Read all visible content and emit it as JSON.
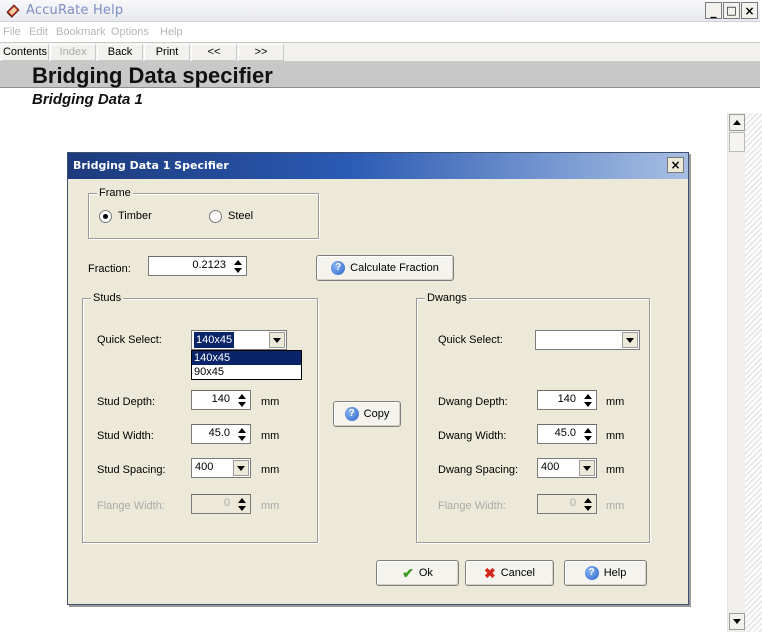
{
  "app": {
    "title": "AccuRate Help",
    "menu": [
      "File",
      "Edit",
      "Bookmark",
      "Options",
      "Help"
    ],
    "toolbar": [
      {
        "label": "Contents",
        "enabled": true
      },
      {
        "label": "Index",
        "enabled": false
      },
      {
        "label": "Back",
        "enabled": true
      },
      {
        "label": "Print",
        "enabled": true
      },
      {
        "label": "<<",
        "enabled": true
      },
      {
        "label": ">>",
        "enabled": true
      }
    ],
    "window_buttons": {
      "minimize": "_",
      "maximize": "□",
      "close": "×"
    }
  },
  "page": {
    "title": "Bridging Data specifier",
    "subtitle": "Bridging Data 1"
  },
  "dialog": {
    "title": "Bridging Data 1 Specifier",
    "close": "×",
    "frame": {
      "group_label": "Frame",
      "options": [
        "Timber",
        "Steel"
      ],
      "selected": "Timber"
    },
    "fraction": {
      "label": "Fraction:",
      "value": "0.2123",
      "calc_button": "Calculate Fraction"
    },
    "studs": {
      "group_label": "Studs",
      "quick_select_label": "Quick Select:",
      "quick_select_value": "140x45",
      "quick_select_options": [
        "140x45",
        "90x45"
      ],
      "depth_label": "Stud Depth:",
      "depth_value": "140",
      "width_label": "Stud Width:",
      "width_value": "45.0",
      "spacing_label": "Stud Spacing:",
      "spacing_value": "400",
      "flange_label": "Flange Width:",
      "flange_value": "0",
      "unit": "mm"
    },
    "copy_button": "Copy",
    "dwangs": {
      "group_label": "Dwangs",
      "quick_select_label": "Quick Select:",
      "quick_select_value": "",
      "depth_label": "Dwang Depth:",
      "depth_value": "140",
      "width_label": "Dwang Width:",
      "width_value": "45.0",
      "spacing_label": "Dwang Spacing:",
      "spacing_value": "400",
      "flange_label": "Flange Width:",
      "flange_value": "0",
      "unit": "mm"
    },
    "buttons": {
      "ok": "Ok",
      "cancel": "Cancel",
      "help": "Help"
    }
  },
  "colors": {
    "dialog_title_start": "#1d3a7c",
    "dialog_title_end": "#a8bfe4",
    "selection": "#0a246a",
    "dialog_bg": "#ece9d8",
    "ok_icon": "#3f9b28",
    "cancel_icon": "#d0281b"
  }
}
